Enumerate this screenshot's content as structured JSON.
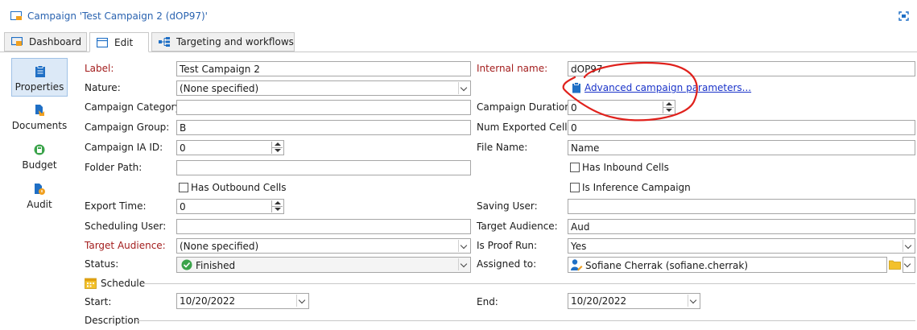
{
  "window": {
    "title": "Campaign 'Test Campaign 2 (dOP97)'"
  },
  "tabs": [
    {
      "label": "Dashboard",
      "icon": "dashboard-icon"
    },
    {
      "label": "Edit",
      "icon": "edit-icon",
      "active": true
    },
    {
      "label": "Targeting and workflows",
      "icon": "workflow-icon"
    }
  ],
  "sidebar": {
    "items": [
      {
        "label": "Properties",
        "icon": "clipboard-icon",
        "active": true
      },
      {
        "label": "Documents",
        "icon": "documents-icon"
      },
      {
        "label": "Budget",
        "icon": "calculator-icon"
      },
      {
        "label": "Audit",
        "icon": "audit-icon"
      }
    ]
  },
  "left": {
    "label": {
      "label": "Label:",
      "value": "Test Campaign 2"
    },
    "nature": {
      "label": "Nature:",
      "value": "(None specified)"
    },
    "campaign_category": {
      "label": "Campaign Category:",
      "value": ""
    },
    "campaign_group": {
      "label": "Campaign Group:",
      "value": "B"
    },
    "campaign_ia_id": {
      "label": "Campaign IA ID:",
      "value": "0"
    },
    "folder_path": {
      "label": "Folder Path:",
      "value": ""
    },
    "has_outbound_cells": {
      "label": "Has Outbound Cells",
      "checked": false
    },
    "export_time": {
      "label": "Export Time:",
      "value": "0"
    },
    "scheduling_user": {
      "label": "Scheduling User:",
      "value": ""
    },
    "target_audience": {
      "label": "Target Audience:",
      "value": "(None specified)"
    },
    "status": {
      "label": "Status:",
      "value": "Finished"
    }
  },
  "right": {
    "internal_name": {
      "label": "Internal name:",
      "value": "dOP97"
    },
    "advanced_link": "Advanced campaign parameters...",
    "campaign_duration": {
      "label": "Campaign Duration:",
      "value": "0"
    },
    "num_exported_cells": {
      "label": "Num Exported Cells:",
      "value": "0"
    },
    "file_name": {
      "label": "File Name:",
      "value": "Name"
    },
    "has_inbound_cells": {
      "label": "Has Inbound Cells",
      "checked": false
    },
    "is_inference_campaign": {
      "label": "Is Inference Campaign",
      "checked": false
    },
    "saving_user": {
      "label": "Saving User:",
      "value": ""
    },
    "target_audience": {
      "label": "Target Audience:",
      "value": "Aud"
    },
    "is_proof_run": {
      "label": "Is Proof Run:",
      "value": "Yes"
    },
    "assigned_to": {
      "label": "Assigned to:",
      "value": "Sofiane Cherrak (sofiane.cherrak)"
    }
  },
  "schedule": {
    "title": "Schedule",
    "start": {
      "label": "Start:",
      "value": "10/20/2022"
    },
    "end": {
      "label": "End:",
      "value": "10/20/2022"
    }
  },
  "description": {
    "title": "Description"
  },
  "colors": {
    "required_label": "#a31d1d",
    "link": "#1a33c9",
    "title": "#2a63b0",
    "annotation": "#e0211c",
    "status_ok": "#3aa34a"
  }
}
